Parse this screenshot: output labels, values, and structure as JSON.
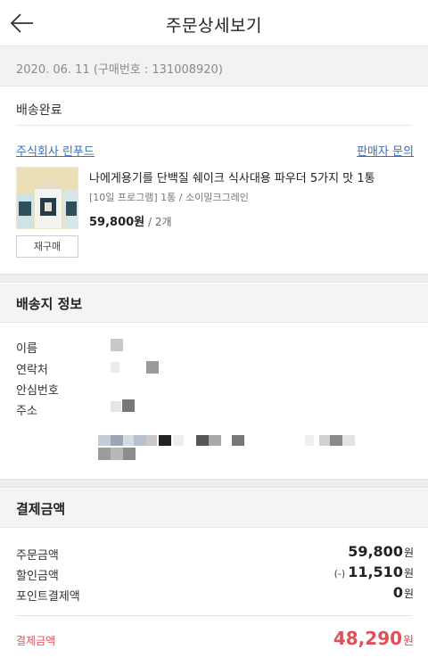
{
  "header": {
    "title": "주문상세보기",
    "back_icon": "arrow-left-icon"
  },
  "order": {
    "date_line": "2020. 06. 11 (구매번호 : 131008920)"
  },
  "status": "배송완료",
  "seller": {
    "name": "주식회사 린푸드",
    "inquiry_label": "판매자 문의"
  },
  "product": {
    "name": "나에게용기를 단백질 쉐이크 식사대용 파우더 5가지 맛 1통",
    "option": "[10일 프로그램] 1통 / 소이밀크그레인",
    "price": "59,800원",
    "quantity": " / 2개",
    "rebuy_label": "재구매"
  },
  "shipping": {
    "section_title": "배송지 정보",
    "labels": [
      "이름",
      "연락처",
      "안심번호",
      "주소"
    ]
  },
  "payment": {
    "section_title": "결제금액",
    "rows": [
      {
        "label": "주문금액",
        "prefix": "",
        "value": "59,800",
        "unit": "원"
      },
      {
        "label": "할인금액",
        "prefix": "(-)",
        "value": "11,510",
        "unit": "원"
      },
      {
        "label": "포인트결제액",
        "prefix": "",
        "value": "0",
        "unit": "원"
      }
    ],
    "total_label": "결제금액",
    "total_value": "48,290",
    "total_unit": "원"
  },
  "colors": {
    "accent_red": "#e0505a",
    "link_blue": "#3a6fbf",
    "band_gray": "#f2f2f2"
  }
}
